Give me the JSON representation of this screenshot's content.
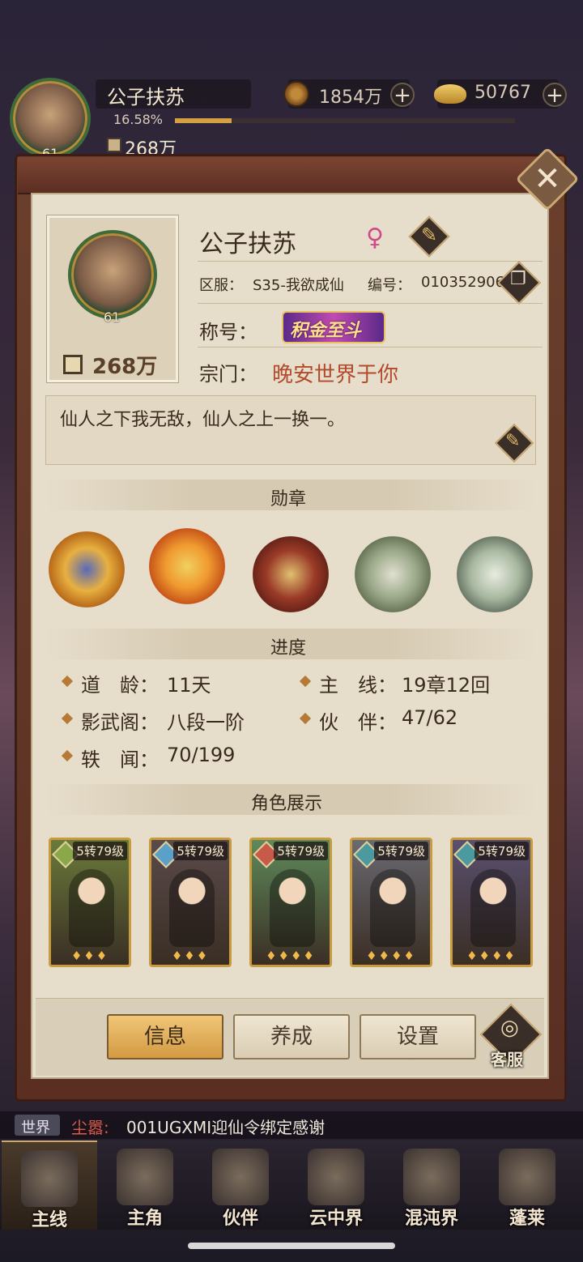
{
  "top": {
    "player_name": "公子扶苏",
    "level": "61",
    "exp_percent": "16.58%",
    "exp_fraction": 0.1658,
    "power": "268万",
    "coins": "1854万",
    "gold": "50767",
    "plus": "+"
  },
  "profile": {
    "name": "公子扶苏",
    "gender_symbol": "♀",
    "server_label": "区服：",
    "server_value": "S35-我欲成仙",
    "id_label": "编号：",
    "id_value": "010352906",
    "title_label": "称号：",
    "title_badge": "积金至斗",
    "sect_label": "宗门：",
    "sect_value": "晚安世界于你",
    "avatar_level": "61",
    "power": "268万",
    "motto": "仙人之下我无敌，仙人之上一换一。"
  },
  "sections": {
    "medals": "勋章",
    "progress": "进度",
    "showcase": "角色展示"
  },
  "progress": [
    {
      "label": "道　龄：",
      "value": "11天"
    },
    {
      "label": "主　线：",
      "value": "19章12回"
    },
    {
      "label": "影武阁：",
      "value": "八段一阶"
    },
    {
      "label": "伙　伴：",
      "value": "47/62"
    },
    {
      "label": "轶　闻：",
      "value": "70/199"
    }
  ],
  "heroes": [
    {
      "level": "5转79级",
      "flames": "♦♦♦",
      "bg": "#6a7a3a",
      "elem": "#8aa84a"
    },
    {
      "level": "5转79级",
      "flames": "♦♦♦",
      "bg": "#5a4a4a",
      "elem": "#5aa0c8"
    },
    {
      "level": "5转79级",
      "flames": "♦♦♦♦",
      "bg": "#5e8a5a",
      "elem": "#c85a4a"
    },
    {
      "level": "5转79级",
      "flames": "♦♦♦♦",
      "bg": "#6a6a72",
      "elem": "#4a9aa0"
    },
    {
      "level": "5转79级",
      "flames": "♦♦♦♦",
      "bg": "#5a5070",
      "elem": "#4a9aa0"
    }
  ],
  "tabs": {
    "info": "信息",
    "train": "养成",
    "settings": "设置",
    "service": "客服"
  },
  "chat": {
    "channel": "世界",
    "sender": "尘嚣:",
    "message": "001UGXMI迎仙令绑定感谢"
  },
  "nav": [
    "主线",
    "主角",
    "伙伴",
    "云中界",
    "混沌界",
    "蓬莱"
  ],
  "colors": {
    "accent_red": "#b24a2c",
    "panel_bg": "#e6ddcb",
    "frame": "#5a2f22",
    "active_tab": "#e3ae5a"
  }
}
